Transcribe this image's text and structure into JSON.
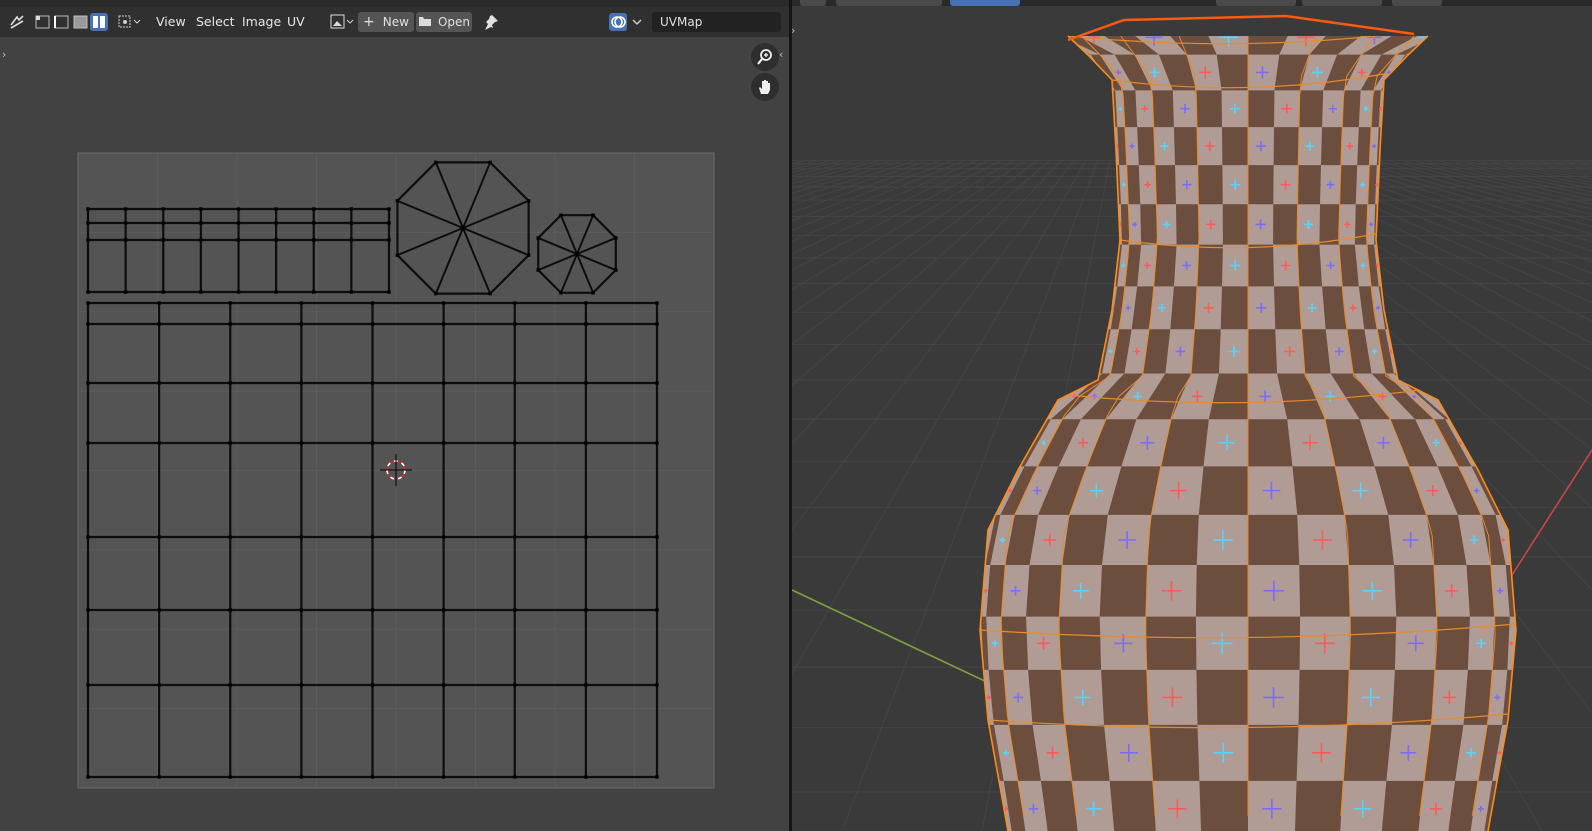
{
  "uv_editor": {
    "menus": [
      "View",
      "Select",
      "Image",
      "UV"
    ],
    "new_label": "New",
    "open_label": "Open",
    "uv_map_name": "UVMap"
  },
  "icons": {
    "sync": "sync-selection-icon",
    "select_vertex": "vertex-select-icon",
    "select_edge": "edge-select-icon",
    "select_face": "face-select-icon",
    "select_island": "island-select-icon",
    "pivot": "pivot-point-icon",
    "image_browse": "image-browse-icon",
    "new": "plus-icon",
    "open": "folder-icon",
    "pin": "pin-icon",
    "overlay": "overlay-icon",
    "zoom": "zoom-icon",
    "pan": "hand-icon"
  },
  "colors": {
    "header_bg": "#303030",
    "accent_blue": "#4772b3",
    "uv_bg": "#424242",
    "edge_orange": "#ff8c1a",
    "checker_dark": "#6b4e3d",
    "checker_light": "#b09c94",
    "axis_green": "#7fa33a",
    "axis_red": "#c9464a"
  }
}
